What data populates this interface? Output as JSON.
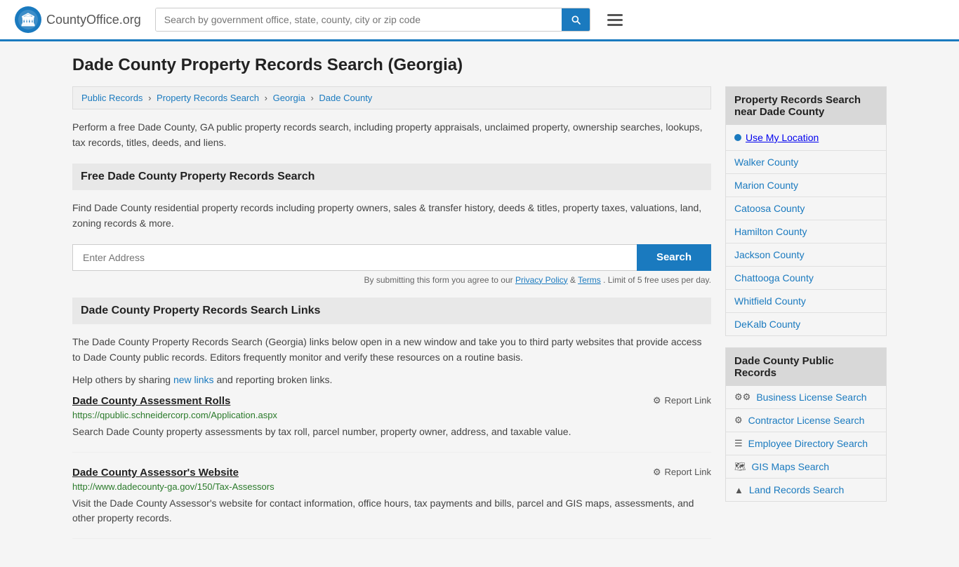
{
  "header": {
    "logo_text": "CountyOffice",
    "logo_suffix": ".org",
    "search_placeholder": "Search by government office, state, county, city or zip code"
  },
  "page": {
    "title": "Dade County Property Records Search (Georgia)"
  },
  "breadcrumb": {
    "items": [
      {
        "label": "Public Records",
        "href": "#"
      },
      {
        "label": "Property Records Search",
        "href": "#"
      },
      {
        "label": "Georgia",
        "href": "#"
      },
      {
        "label": "Dade County",
        "href": "#"
      }
    ]
  },
  "main_description": "Perform a free Dade County, GA public property records search, including property appraisals, unclaimed property, ownership searches, lookups, tax records, titles, deeds, and liens.",
  "free_search": {
    "heading": "Free Dade County Property Records Search",
    "description": "Find Dade County residential property records including property owners, sales & transfer history, deeds & titles, property taxes, valuations, land, zoning records & more.",
    "address_placeholder": "Enter Address",
    "search_button": "Search",
    "terms_text": "By submitting this form you agree to our",
    "privacy_label": "Privacy Policy",
    "and_text": "&",
    "terms_label": "Terms",
    "limit_text": ". Limit of 5 free uses per day."
  },
  "search_links": {
    "heading": "Dade County Property Records Search Links",
    "description_before": "The Dade County Property Records Search (Georgia) links below open in a new window and take you to third party websites that provide access to Dade County public records. Editors frequently monitor and verify these resources on a routine basis.",
    "description_share": "Help others by sharing",
    "new_links_text": "new links",
    "description_after": "and reporting broken links.",
    "items": [
      {
        "title": "Dade County Assessment Rolls",
        "url": "https://qpublic.schneidercorp.com/Application.aspx",
        "description": "Search Dade County property assessments by tax roll, parcel number, property owner, address, and taxable value.",
        "report_text": "Report Link"
      },
      {
        "title": "Dade County Assessor's Website",
        "url": "http://www.dadecounty-ga.gov/150/Tax-Assessors",
        "description": "Visit the Dade County Assessor's website for contact information, office hours, tax payments and bills, parcel and GIS maps, assessments, and other property records.",
        "report_text": "Report Link"
      }
    ]
  },
  "sidebar": {
    "nearby_heading": "Property Records Search near Dade County",
    "use_my_location": "Use My Location",
    "nearby_counties": [
      {
        "label": "Walker County"
      },
      {
        "label": "Marion County"
      },
      {
        "label": "Catoosa County"
      },
      {
        "label": "Hamilton County"
      },
      {
        "label": "Jackson County"
      },
      {
        "label": "Chattooga County"
      },
      {
        "label": "Whitfield County"
      },
      {
        "label": "DeKalb County"
      }
    ],
    "public_records_heading": "Dade County Public Records",
    "public_records_items": [
      {
        "icon": "⚙⚙",
        "label": "Business License Search"
      },
      {
        "icon": "⚙",
        "label": "Contractor License Search"
      },
      {
        "icon": "☰",
        "label": "Employee Directory Search"
      },
      {
        "icon": "🗺",
        "label": "GIS Maps Search"
      },
      {
        "icon": "▲",
        "label": "Land Records Search"
      }
    ]
  }
}
